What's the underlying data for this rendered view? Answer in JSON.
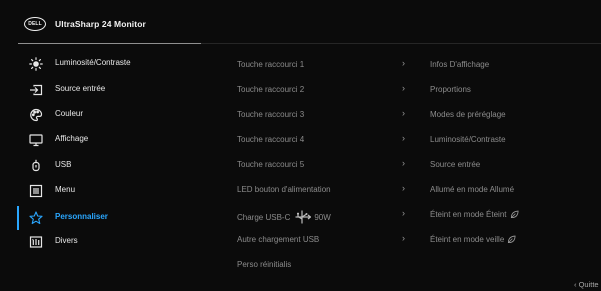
{
  "header": {
    "logo_text": "DELL",
    "title": "UltraSharp 24 Monitor"
  },
  "colors": {
    "accent": "#2aa7ff",
    "background": "#0b0b0b",
    "text": "#e6e6e6",
    "muted": "#8c8c8c"
  },
  "sidebar": {
    "items": [
      {
        "label": "Luminosité/Contraste",
        "icon": "brightness-icon"
      },
      {
        "label": "Source entrée",
        "icon": "input-source-icon"
      },
      {
        "label": "Couleur",
        "icon": "color-palette-icon"
      },
      {
        "label": "Affichage",
        "icon": "display-monitor-icon"
      },
      {
        "label": "USB",
        "icon": "usb-plug-icon"
      },
      {
        "label": "Menu",
        "icon": "menu-list-icon"
      },
      {
        "label": "Personnaliser",
        "icon": "star-icon",
        "selected": true
      },
      {
        "label": "Divers",
        "icon": "info-icon"
      }
    ]
  },
  "options": [
    {
      "label": "Touche raccourci 1",
      "value": "Infos D'affichage"
    },
    {
      "label": "Touche raccourci 2",
      "value": "Proportions"
    },
    {
      "label": "Touche raccourci 3",
      "value": "Modes de préréglage"
    },
    {
      "label": "Touche raccourci 4",
      "value": "Luminosité/Contraste"
    },
    {
      "label": "Touche raccourci 5",
      "value": "Source entrée"
    },
    {
      "label": "LED bouton d'alimentation",
      "value": "Allumé en mode Allumé"
    },
    {
      "label": "Charge USB-C",
      "label_suffix": "90W",
      "label_icon": "usb-charging-icon",
      "value": "Éteint en mode Éteint",
      "value_icon": "eco-leaf-icon"
    },
    {
      "label": "Autre chargement USB",
      "value": "Éteint en mode veille",
      "value_icon": "eco-leaf-icon"
    },
    {
      "label": "Perso réinitialis"
    }
  ],
  "chevron": "›",
  "footer": {
    "quit_label": "‹ Quitte"
  }
}
